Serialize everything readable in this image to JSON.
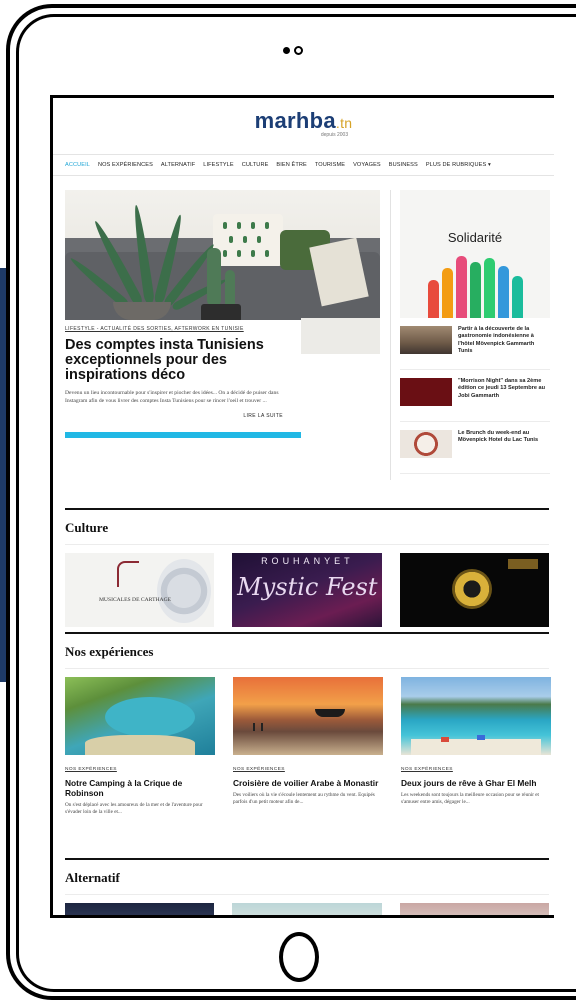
{
  "site": {
    "logo_main": "marhba",
    "logo_tld": ".tn",
    "logo_sub": "depuis 2003"
  },
  "nav": {
    "items": [
      {
        "label": "ACCUEIL",
        "active": true
      },
      {
        "label": "NOS EXPÉRIENCES",
        "active": false
      },
      {
        "label": "ALTERNATIF",
        "active": false
      },
      {
        "label": "LIFESTYLE",
        "active": false
      },
      {
        "label": "CULTURE",
        "active": false
      },
      {
        "label": "BIEN ÊTRE",
        "active": false
      },
      {
        "label": "TOURISME",
        "active": false
      },
      {
        "label": "VOYAGES",
        "active": false
      },
      {
        "label": "BUSINESS",
        "active": false
      },
      {
        "label": "PLUS DE RUBRIQUES ▾",
        "active": false
      }
    ]
  },
  "featured": {
    "kicker": "LIFESTYLE - ACTUALITÉ DES SORTIES, AFTERWORK EN TUNISIE",
    "title": "Des comptes insta Tunisiens exceptionnels pour des inspirations déco",
    "excerpt": "Devenu un lieu incontournable pour s'inspirer et piocher des idées... On a décidé de puiser dans Instagram afin de vous livrer des comptes Insta Tunisiens pour se rincer l'oeil et trouver ...",
    "read_more": "LIRE LA SUITE"
  },
  "sidebar": {
    "banner_label": "Solidarité",
    "items": [
      {
        "text": "Partir à la découverte de la gastronomie indonésienne à l'hôtel Mövenpick Gammarth Tunis"
      },
      {
        "text": "\"Morrison Night\" dans sa 2ème édition ce jeudi 13 Septembre au Jobi Gammarth"
      },
      {
        "text": "Le Brunch du week-end au Mövenpick Hotel du Lac Tunis"
      }
    ]
  },
  "culture": {
    "title": "Culture",
    "cards": [
      {
        "text": "MUSICALES DE CARTHAGE"
      },
      {
        "text_top": "ROUHANYET",
        "text_script": "Mystic Fest"
      },
      {
        "text": ""
      }
    ]
  },
  "experiences": {
    "title": "Nos expériences",
    "cards": [
      {
        "kicker": "NOS EXPÉRIENCES",
        "title": "Notre Camping à la Crique de Robinson",
        "excerpt": "On s'est déplacé avec les amoureux de la mer et de l'aventure pour s'évader loin de la ville et..."
      },
      {
        "kicker": "NOS EXPÉRIENCES",
        "title": "Croisière de voilier Arabe à Monastir",
        "excerpt": "Des voiliers où la vie s'écoule lentement au rythme du vent. Equipés parfois d'un petit moteur afin de..."
      },
      {
        "kicker": "NOS EXPÉRIENCES",
        "title": "Deux jours de rêve à Ghar El Melh",
        "excerpt": "Les weekends sont toujours la meilleure occasion pour se réunir et s'amuser entre amis, dégager le..."
      }
    ]
  },
  "alternatif": {
    "title": "Alternatif"
  },
  "colors": {
    "brand_blue": "#1c3e75",
    "accent_cyan": "#21a6d6",
    "logo_gold": "#d6a327",
    "backdrop_navy": "#1e3a66"
  }
}
